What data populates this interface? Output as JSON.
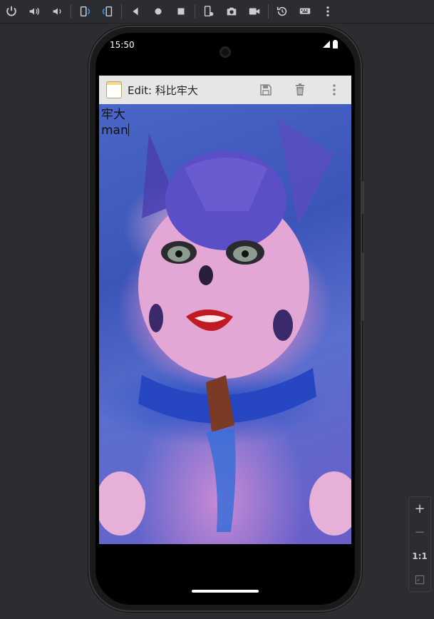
{
  "emulator": {
    "toolbar": [
      {
        "name": "power-icon"
      },
      {
        "name": "volume-up-icon"
      },
      {
        "name": "volume-down-icon"
      },
      {
        "name": "rotate-left-icon"
      },
      {
        "name": "rotate-right-icon"
      },
      {
        "name": "back-icon"
      },
      {
        "name": "home-icon"
      },
      {
        "name": "overview-icon"
      },
      {
        "name": "device-settings-icon"
      },
      {
        "name": "camera-icon"
      },
      {
        "name": "video-icon"
      },
      {
        "name": "snapshot-icon"
      },
      {
        "name": "keyboard-icon"
      },
      {
        "name": "more-icon"
      }
    ],
    "zoom": {
      "zoom_in": "+",
      "zoom_out": "−",
      "actual_size": "1:1"
    }
  },
  "device": {
    "status": {
      "time": "15:50"
    }
  },
  "app": {
    "title": "Edit: 科比牢大",
    "actions": [
      "save-icon",
      "delete-icon",
      "overflow-menu-icon"
    ],
    "editor": {
      "lines": [
        "牢大",
        "man"
      ]
    }
  },
  "colors": {
    "toolbar_bg": "#2b2d30",
    "appbar_bg": "#e6e6e6",
    "accent_purple": "#6b5ec8"
  }
}
